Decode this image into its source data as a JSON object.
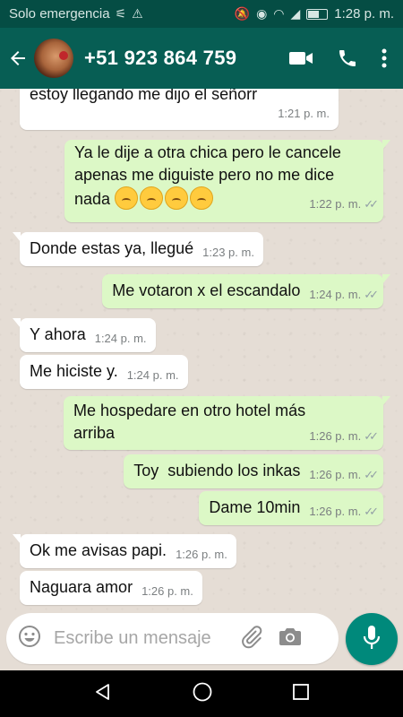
{
  "status_bar": {
    "carrier": "Solo emergencia",
    "time": "1:28 p. m."
  },
  "header": {
    "contact": "+51 923 864 759"
  },
  "messages": [
    {
      "dir": "in",
      "text": "estoy llegando me dijo el señorr",
      "time": "1:21 p. m."
    },
    {
      "dir": "out",
      "text": "Ya le dije a otra chica pero le cancele apenas me diguiste pero no me dice nada",
      "emojis": [
        "confounded-face-emoji",
        "frowning-face-emoji",
        "confounded-face-emoji",
        "frowning-face-emoji"
      ],
      "time": "1:22 p. m."
    },
    {
      "dir": "in",
      "text": "Donde estas ya, llegué",
      "time": "1:23 p. m."
    },
    {
      "dir": "out",
      "text": "Me votaron x el escandalo",
      "time": "1:24 p. m."
    },
    {
      "dir": "in",
      "text": "Y ahora",
      "time": "1:24 p. m."
    },
    {
      "dir": "in",
      "text": "Me hiciste y.",
      "time": "1:24 p. m."
    },
    {
      "dir": "out",
      "text": "Me hospedare en otro hotel más arriba",
      "time": "1:26 p. m."
    },
    {
      "dir": "out",
      "text": "Toy  subiendo los inkas",
      "time": "1:26 p. m."
    },
    {
      "dir": "out",
      "text": "Dame 10min",
      "time": "1:26 p. m."
    },
    {
      "dir": "in",
      "text": "Ok me avisas papi.",
      "time": "1:26 p. m."
    },
    {
      "dir": "in",
      "text": "Naguara amor",
      "time": "1:26 p. m."
    }
  ],
  "composer": {
    "placeholder": "Escribe un mensaje"
  },
  "colors": {
    "header": "#075e54",
    "status_bar": "#054d44",
    "outgoing_bubble": "#dcf8c6",
    "incoming_bubble": "#ffffff",
    "chat_bg": "#e5ddd5",
    "mic_button": "#00897b"
  }
}
